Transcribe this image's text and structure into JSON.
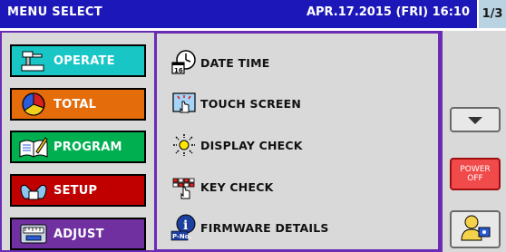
{
  "header": {
    "title": "MENU SELECT",
    "datetime": "APR.17.2015 (FRI) 16:10",
    "page": "1/3"
  },
  "sidebar": {
    "items": [
      {
        "label": "OPERATE",
        "icon": "operate-icon",
        "color": "#18c6c6"
      },
      {
        "label": "TOTAL",
        "icon": "pie-chart-icon",
        "color": "#e46c0a"
      },
      {
        "label": "PROGRAM",
        "icon": "book-pencil-icon",
        "color": "#00b050"
      },
      {
        "label": "SETUP",
        "icon": "setup-hands-icon",
        "color": "#c00000"
      },
      {
        "label": "ADJUST",
        "icon": "adjust-scale-icon",
        "color": "#7030a0"
      }
    ]
  },
  "main": {
    "items": [
      {
        "label": "DATE TIME",
        "icon": "clock-calendar-icon"
      },
      {
        "label": "TOUCH SCREEN",
        "icon": "touch-screen-icon"
      },
      {
        "label": "DISPLAY CHECK",
        "icon": "sun-icon"
      },
      {
        "label": "KEY CHECK",
        "icon": "key-check-icon"
      },
      {
        "label": "FIRMWARE DETAILS",
        "icon": "info-icon",
        "icon_text": "P-No."
      }
    ]
  },
  "right": {
    "power_label_line1": "POWER",
    "power_label_line2": "OFF",
    "down_icon": "down-arrow-icon",
    "user_icon": "user-icon"
  },
  "colors": {
    "header_bg": "#1c17b8",
    "page_indicator_bg": "#b9d3e2",
    "panel_border": "#6a2bb5",
    "panel_bg": "#d9d9d9",
    "power_bg": "#f04a4a"
  }
}
